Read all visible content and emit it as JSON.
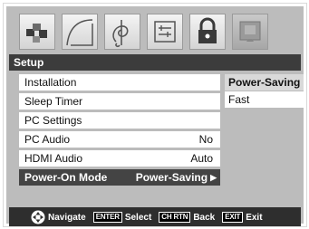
{
  "menu": {
    "title": "Setup",
    "items": [
      {
        "label": "Installation",
        "value": ""
      },
      {
        "label": "Sleep Timer",
        "value": ""
      },
      {
        "label": "PC Settings",
        "value": ""
      },
      {
        "label": "PC Audio",
        "value": "No"
      },
      {
        "label": "HDMI Audio",
        "value": "Auto"
      },
      {
        "label": "Power-On Mode",
        "value": "Power-Saving"
      }
    ],
    "submenu": [
      "Power-Saving",
      "Fast"
    ]
  },
  "footer": {
    "navigate_label": "Navigate",
    "enter_key": "ENTER",
    "select_label": "Select",
    "chrtn_key": "CH RTN",
    "back_label": "Back",
    "exit_key": "EXIT",
    "exit_label": "Exit"
  },
  "icons": [
    "picture-icon",
    "audio-icon",
    "music-icon",
    "preferences-icon",
    "lock-icon",
    "setup-icon"
  ],
  "colors": {
    "title_bar": "#3c3c3c",
    "selected_item": "#444444",
    "screen_bg": "#bcbcbc"
  }
}
